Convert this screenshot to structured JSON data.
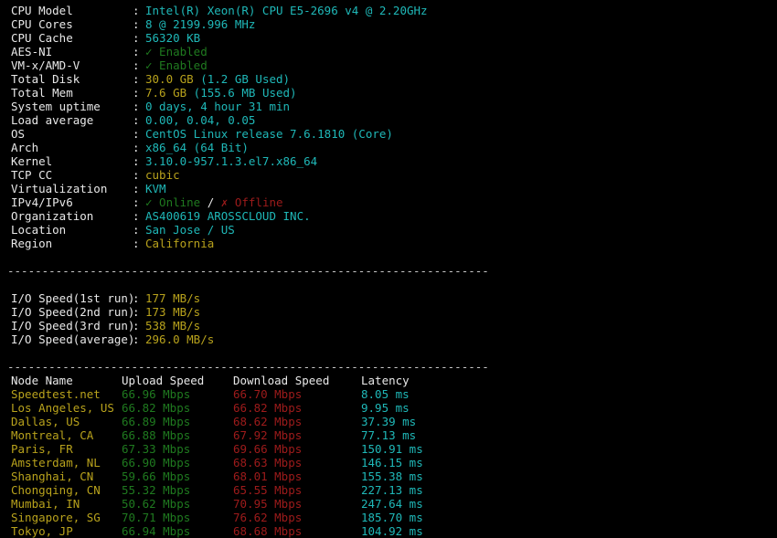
{
  "terminal": {
    "background": "#000000",
    "foreground": "#e8e8e8",
    "colors": {
      "cyan": "#1fb8b8",
      "yellow": "#b8a21c",
      "green_dim": "#1f7a1f",
      "red_dim": "#9e1b1b",
      "white": "#e8e8e8"
    },
    "separator": "----------------------------------------------------------------------"
  },
  "system_info": [
    {
      "label": "CPU Model",
      "value": "Intel(R) Xeon(R) CPU E5-2696 v4 @ 2.20GHz"
    },
    {
      "label": "CPU Cores",
      "value": "8 @ 2199.996 MHz"
    },
    {
      "label": "CPU Cache",
      "value": "56320 KB"
    },
    {
      "label": "AES-NI",
      "value": "✓ Enabled"
    },
    {
      "label": "VM-x/AMD-V",
      "value": "✓ Enabled"
    },
    {
      "label": "Total Disk",
      "value": "30.0 GB",
      "extra": " (1.2 GB Used)"
    },
    {
      "label": "Total Mem",
      "value": "7.6 GB",
      "extra": " (155.6 MB Used)"
    },
    {
      "label": "System uptime",
      "value": "0 days, 4 hour 31 min"
    },
    {
      "label": "Load average",
      "value": "0.00, 0.04, 0.05"
    },
    {
      "label": "OS",
      "value": "CentOS Linux release 7.6.1810 (Core)"
    },
    {
      "label": "Arch",
      "value": "x86_64 (64 Bit)"
    },
    {
      "label": "Kernel",
      "value": "3.10.0-957.1.3.el7.x86_64"
    },
    {
      "label": "TCP CC",
      "value": "cubic"
    },
    {
      "label": "Virtualization",
      "value": "KVM"
    },
    {
      "label": "IPv4/IPv6",
      "value_online": "✓ Online",
      "value_sep": " / ",
      "value_offline": "✗ Offline"
    },
    {
      "label": "Organization",
      "value": "AS400619 AROSSCLOUD INC."
    },
    {
      "label": "Location",
      "value": "San Jose / US"
    },
    {
      "label": "Region",
      "value": "California"
    }
  ],
  "io_speed": [
    {
      "label": "I/O Speed(1st run)",
      "value": "177 MB/s"
    },
    {
      "label": "I/O Speed(2nd run)",
      "value": "173 MB/s"
    },
    {
      "label": "I/O Speed(3rd run)",
      "value": "538 MB/s"
    },
    {
      "label": "I/O Speed(average)",
      "value": "296.0 MB/s"
    }
  ],
  "speedtest": {
    "headers": {
      "node": "Node Name",
      "upload": "Upload Speed",
      "download": "Download Speed",
      "latency": "Latency"
    },
    "rows": [
      {
        "node": "Speedtest.net",
        "upload": "66.96 Mbps",
        "download": "66.70 Mbps",
        "latency": "8.05 ms"
      },
      {
        "node": "Los Angeles, US",
        "upload": "66.82 Mbps",
        "download": "66.82 Mbps",
        "latency": "9.95 ms"
      },
      {
        "node": "Dallas, US",
        "upload": "66.89 Mbps",
        "download": "68.62 Mbps",
        "latency": "37.39 ms"
      },
      {
        "node": "Montreal, CA",
        "upload": "66.88 Mbps",
        "download": "67.92 Mbps",
        "latency": "77.13 ms"
      },
      {
        "node": "Paris, FR",
        "upload": "67.33 Mbps",
        "download": "69.66 Mbps",
        "latency": "150.91 ms"
      },
      {
        "node": "Amsterdam, NL",
        "upload": "66.90 Mbps",
        "download": "68.63 Mbps",
        "latency": "146.15 ms"
      },
      {
        "node": "Shanghai, CN",
        "upload": "59.66 Mbps",
        "download": "68.01 Mbps",
        "latency": "155.38 ms"
      },
      {
        "node": "Chongqing, CN",
        "upload": "55.32 Mbps",
        "download": "65.55 Mbps",
        "latency": "227.13 ms"
      },
      {
        "node": "Mumbai, IN",
        "upload": "50.62 Mbps",
        "download": "70.95 Mbps",
        "latency": "247.64 ms"
      },
      {
        "node": "Singapore, SG",
        "upload": "70.71 Mbps",
        "download": "76.62 Mbps",
        "latency": "185.70 ms"
      },
      {
        "node": "Tokyo, JP",
        "upload": "66.94 Mbps",
        "download": "68.68 Mbps",
        "latency": "104.92 ms"
      }
    ]
  }
}
